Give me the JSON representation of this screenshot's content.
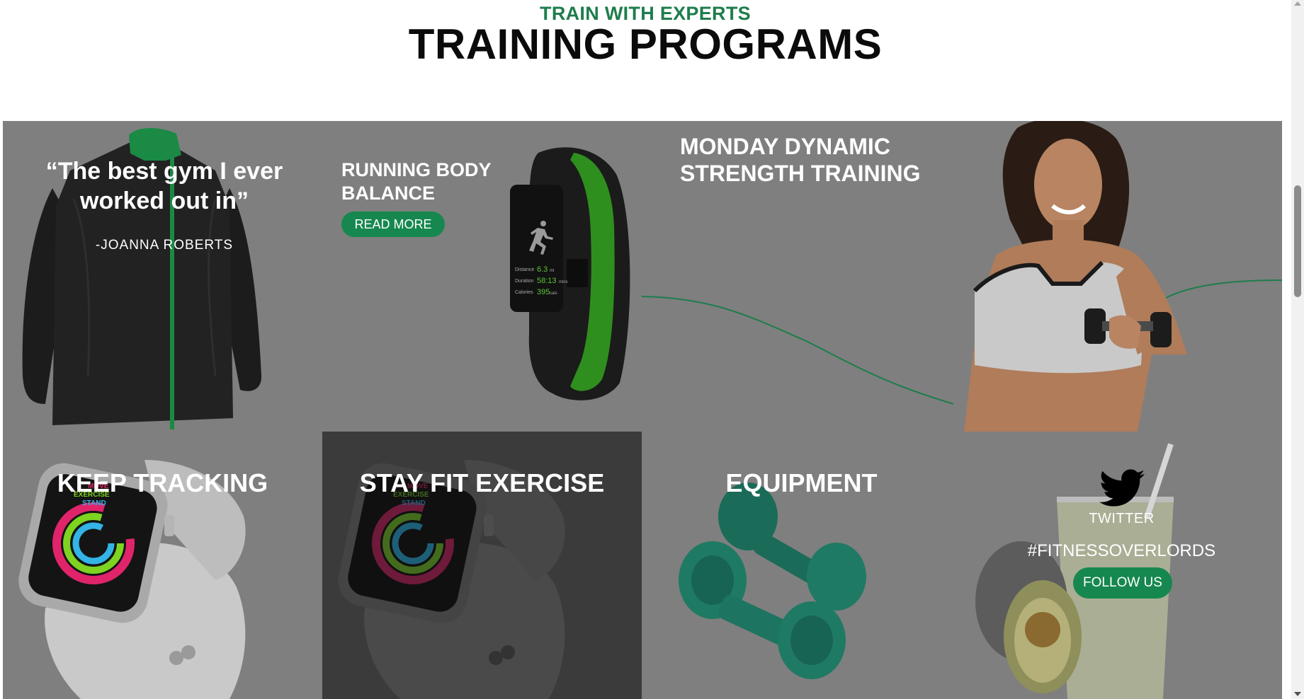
{
  "header": {
    "eyebrow": "TRAIN WITH EXPERTS",
    "title": "TRAINING PROGRAMS"
  },
  "tiles": {
    "testimonial": {
      "quote": "“The best gym I ever worked out in”",
      "author": "-JOANNA ROBERTS"
    },
    "running": {
      "title": "RUNNING BODY BALANCE",
      "button": "READ MORE",
      "tracker_readout": {
        "distance_label": "Distance",
        "distance_value": "6.3",
        "distance_unit": "mi",
        "duration_label": "Duration",
        "duration_value": "58:13",
        "duration_unit": "mins",
        "calories_label": "Calories",
        "calories_value": "395",
        "calories_unit": "cals"
      }
    },
    "monday": {
      "title": "MONDAY DYNAMIC STRENGTH TRAINING"
    },
    "keep_tracking": {
      "title": "KEEP TRACKING",
      "watch_rings": [
        "MOVE",
        "EXERCISE",
        "STAND"
      ]
    },
    "stay_fit": {
      "title": "STAY FIT EXERCISE",
      "watch_rings": [
        "MOVE",
        "EXERCISE",
        "STAND"
      ]
    },
    "equipment": {
      "title": "EQUIPMENT"
    },
    "twitter": {
      "label": "TWITTER",
      "hashtag": "#FITNESSOVERLORDS",
      "button": "FOLLOW US"
    }
  },
  "colors": {
    "accent_green": "#16884f",
    "eyebrow_green": "#1e7d4c",
    "tile_gray": "#7f7f7f",
    "tile_dark": "#3b3b3b",
    "dumbbell_green": "#1f6f5c"
  },
  "icons": [
    "twitter-bird-icon",
    "running-person-icon"
  ]
}
